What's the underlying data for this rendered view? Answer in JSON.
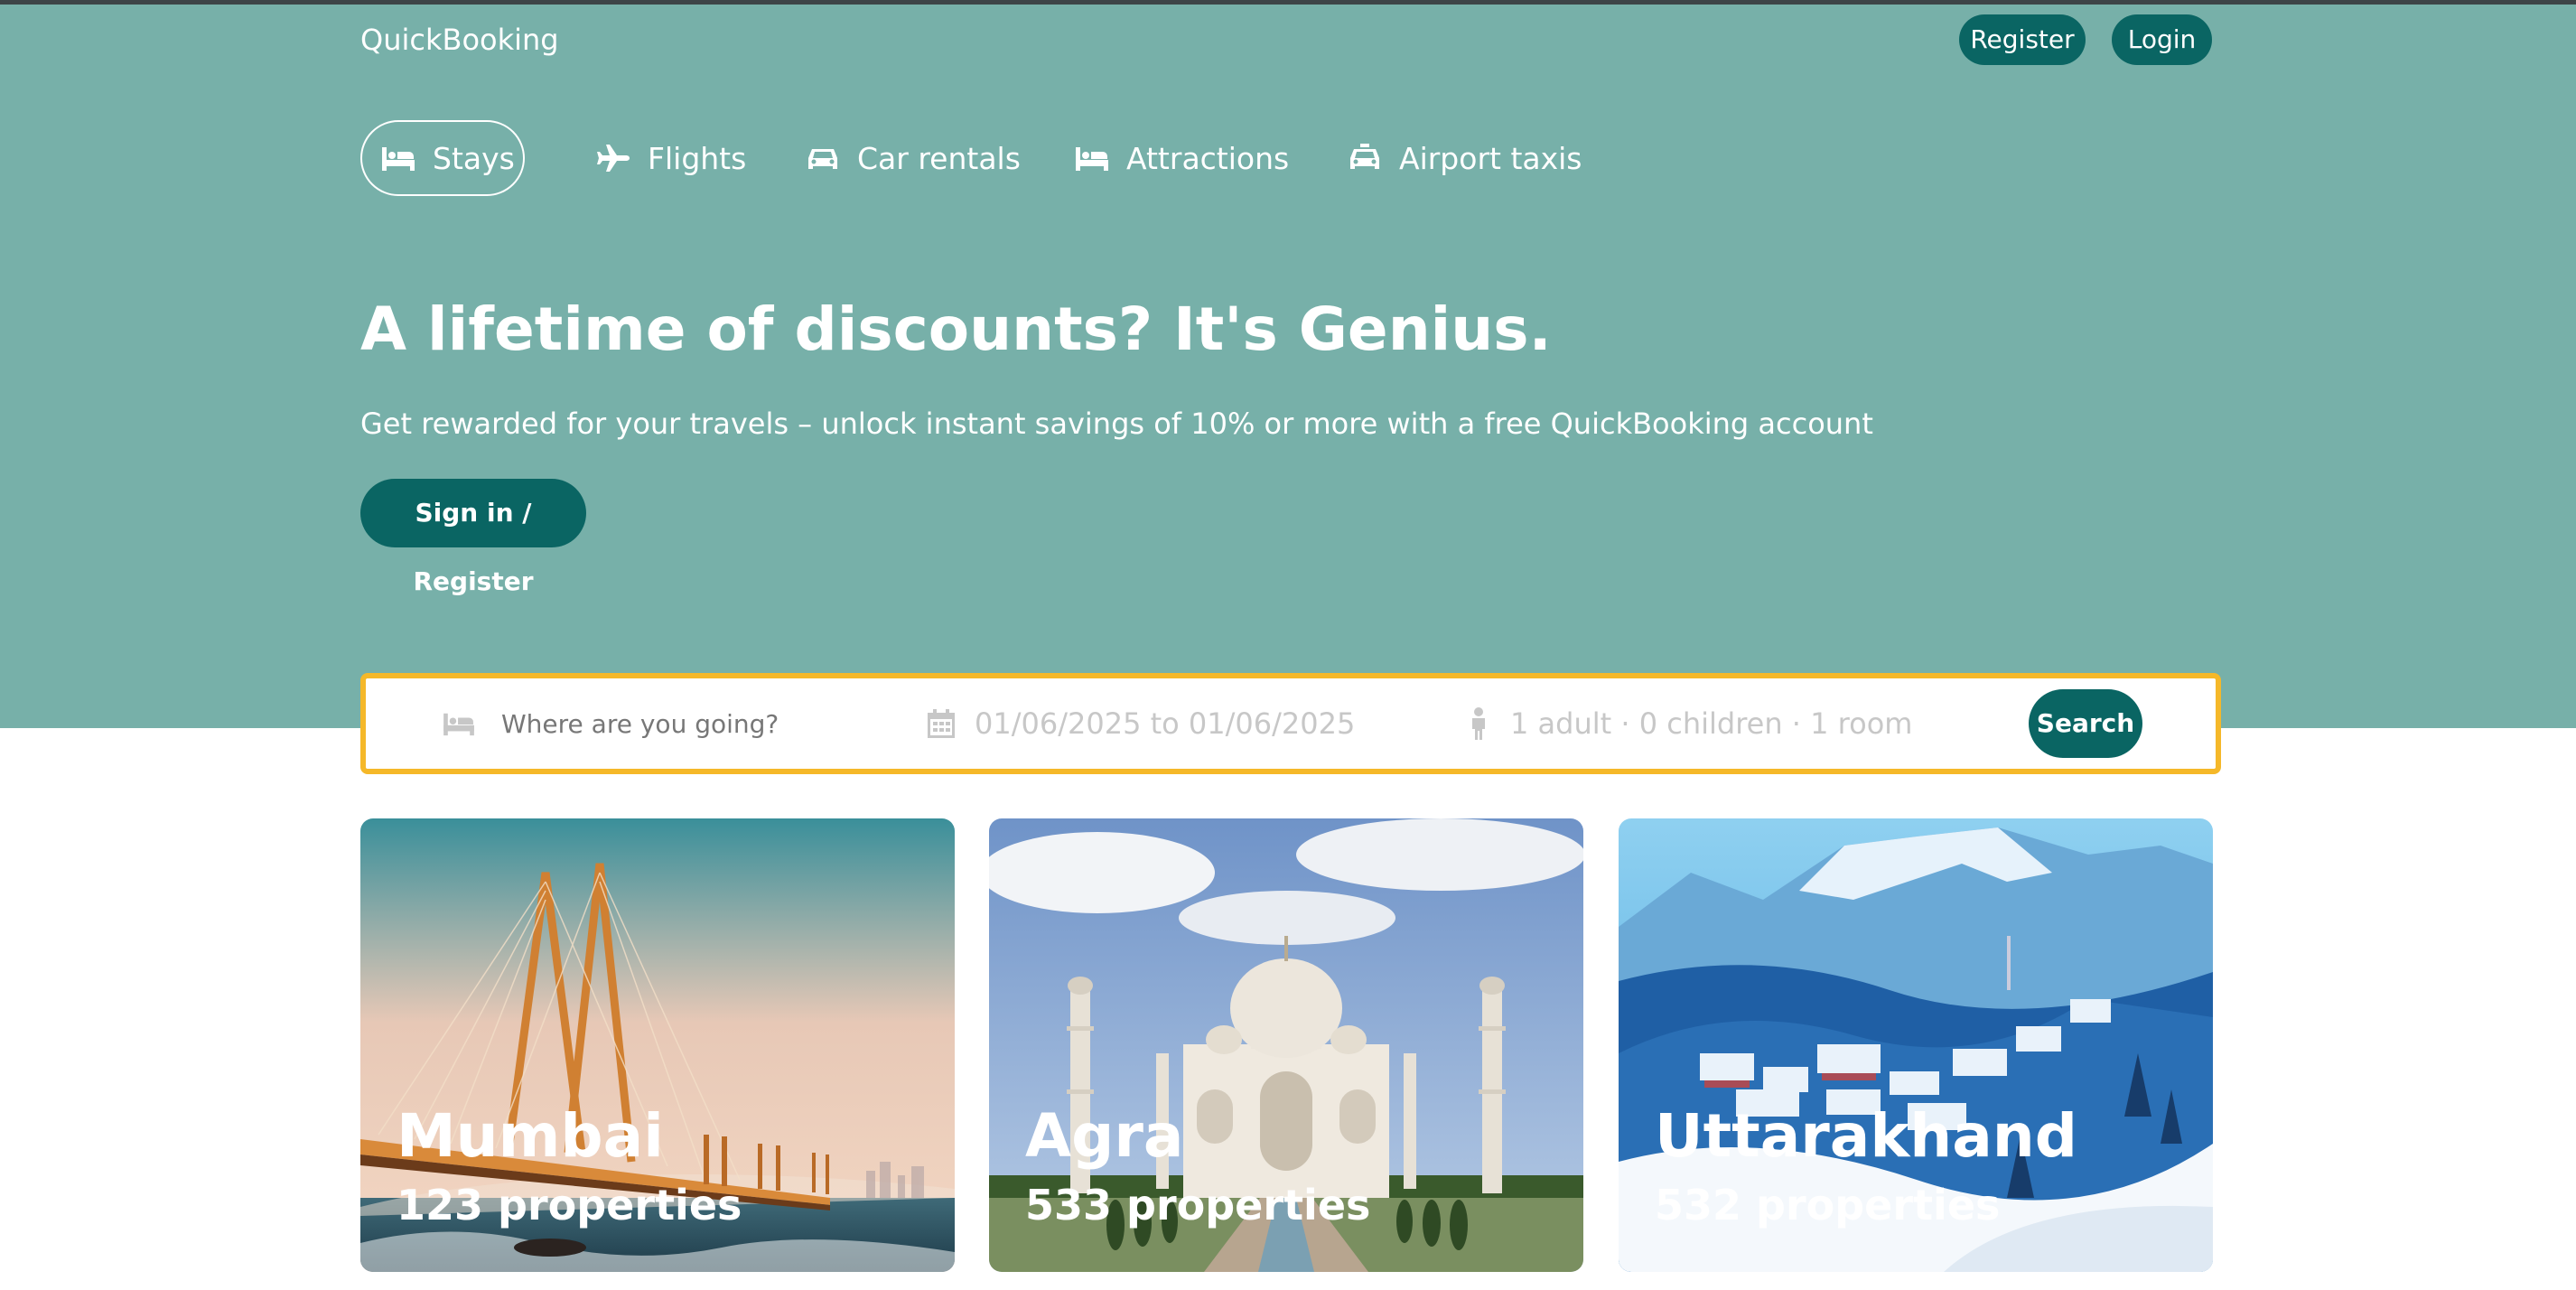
{
  "app": {
    "brand": "QuickBooking",
    "accent_color": "#0a6563",
    "hero_color": "#77b0a9",
    "search_border_color": "#f5b829"
  },
  "header": {
    "register_label": "Register",
    "login_label": "Login"
  },
  "tabs": [
    {
      "label": "Stays",
      "icon": "bed-icon",
      "active": true
    },
    {
      "label": "Flights",
      "icon": "plane-icon",
      "active": false
    },
    {
      "label": "Car rentals",
      "icon": "car-icon",
      "active": false
    },
    {
      "label": "Attractions",
      "icon": "bed-icon",
      "active": false
    },
    {
      "label": "Airport taxis",
      "icon": "taxi-icon",
      "active": false
    }
  ],
  "hero": {
    "title": "A lifetime of discounts? It's Genius.",
    "subtitle": "Get rewarded for your travels – unlock instant savings of 10% or more with a free QuickBooking account",
    "signin_label": "Sign in / Register"
  },
  "search": {
    "destination_placeholder": "Where are you going?",
    "destination_icon": "bed-icon",
    "dates": "01/06/2025 to 01/06/2025",
    "dates_icon": "calendar-icon",
    "guests": "1 adult · 0 children · 1 room",
    "guests_icon": "person-icon",
    "button_label": "Search"
  },
  "destinations": [
    {
      "name": "Mumbai",
      "properties": "123 properties"
    },
    {
      "name": "Agra",
      "properties": "533 properties"
    },
    {
      "name": "Uttarakhand",
      "properties": "532 properties"
    }
  ]
}
